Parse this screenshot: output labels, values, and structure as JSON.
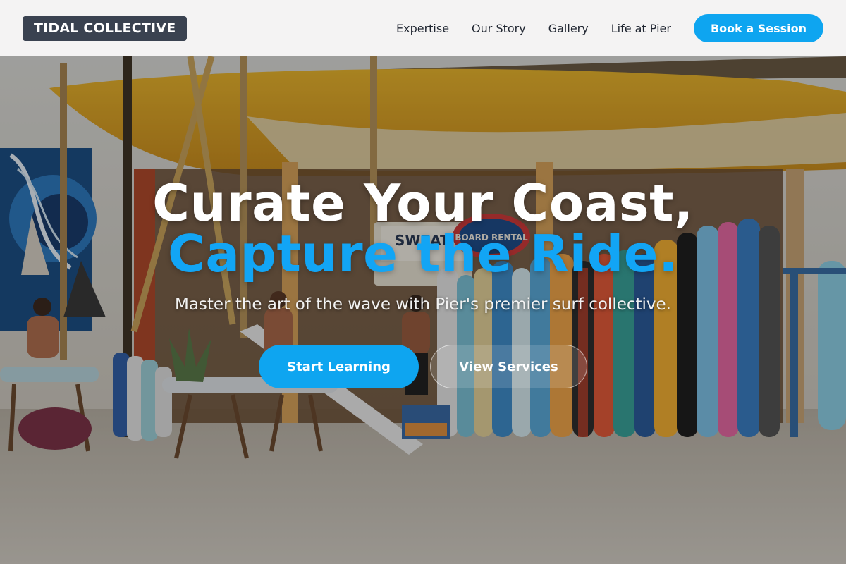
{
  "brand": {
    "name": "TIDAL COLLECTIVE"
  },
  "nav": {
    "items": [
      {
        "label": "Expertise"
      },
      {
        "label": "Our Story"
      },
      {
        "label": "Gallery"
      },
      {
        "label": "Life at Pier"
      }
    ],
    "cta_label": "Book a Session"
  },
  "hero": {
    "headline_line1": "Curate Your Coast,",
    "headline_line2": "Capture the Ride.",
    "subtitle": "Master the art of the wave with Pier's premier surf collective.",
    "primary_button": "Start Learning",
    "secondary_button": "View Services",
    "scene_signs": {
      "rental": "BOARD RENTAL",
      "sweat": "SWEAT"
    }
  },
  "colors": {
    "accent": "#0ea5f0",
    "logo_bg": "#3a4250",
    "header_bg": "#f5f5f5"
  }
}
